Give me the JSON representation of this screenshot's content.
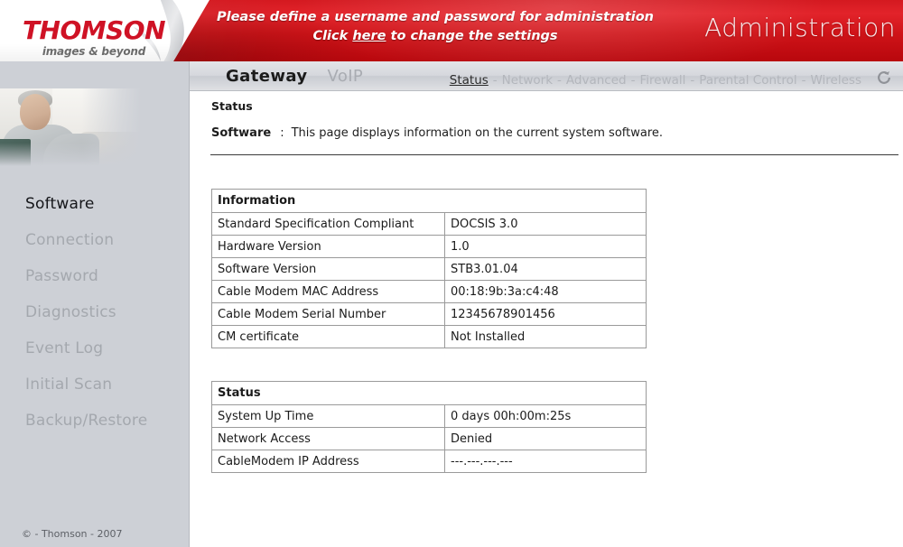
{
  "banner": {
    "notice_line1": "Please define a username and password for administration",
    "notice_click": "Click",
    "notice_link": "here",
    "notice_rest": "to change the settings",
    "title": "Administration",
    "logo_word": "THOMSON",
    "logo_tagline": "images & beyond",
    "red": "#d41920"
  },
  "nav": {
    "primary": [
      {
        "label": "Gateway",
        "active": true
      },
      {
        "label": "VoIP",
        "active": false
      }
    ],
    "secondary": [
      {
        "label": "Status",
        "active": true
      },
      {
        "label": "Network",
        "active": false
      },
      {
        "label": "Advanced",
        "active": false
      },
      {
        "label": "Firewall",
        "active": false
      },
      {
        "label": "Parental Control",
        "active": false
      },
      {
        "label": "Wireless",
        "active": false
      }
    ],
    "separator": "-",
    "refresh_icon": "refresh-icon"
  },
  "sidebar": {
    "items": [
      {
        "label": "Software",
        "active": true
      },
      {
        "label": "Connection",
        "active": false
      },
      {
        "label": "Password",
        "active": false
      },
      {
        "label": "Diagnostics",
        "active": false
      },
      {
        "label": "Event Log",
        "active": false
      },
      {
        "label": "Initial Scan",
        "active": false
      },
      {
        "label": "Backup/Restore",
        "active": false
      }
    ],
    "footer": "© - Thomson - 2007",
    "photo_alt": "man-with-laptop-photo"
  },
  "main": {
    "breadcrumb": "Status",
    "page_label": "Software",
    "colon": ":",
    "description": "This page displays information on the current system software.",
    "information_table": {
      "header": "Information",
      "rows": [
        {
          "label": "Standard Specification Compliant",
          "value": "DOCSIS 3.0"
        },
        {
          "label": "Hardware Version",
          "value": "1.0"
        },
        {
          "label": "Software Version",
          "value": "STB3.01.04"
        },
        {
          "label": "Cable Modem MAC Address",
          "value": "00:18:9b:3a:c4:48"
        },
        {
          "label": "Cable Modem Serial Number",
          "value": "12345678901456"
        },
        {
          "label": "CM certificate",
          "value": "Not Installed"
        }
      ]
    },
    "status_table": {
      "header": "Status",
      "rows": [
        {
          "label": "System Up Time",
          "value": "0 days 00h:00m:25s"
        },
        {
          "label": "Network Access",
          "value": "Denied"
        },
        {
          "label": "CableModem IP Address",
          "value": "---.---.---.---"
        }
      ]
    }
  }
}
